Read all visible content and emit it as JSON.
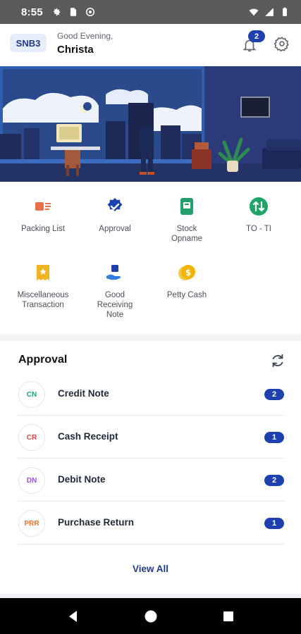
{
  "status_bar": {
    "time": "8:55",
    "left_icons": [
      "gear-icon",
      "sim-card-icon",
      "settings-cog-icon"
    ],
    "right_icons": [
      "wifi-icon",
      "cellular-icon",
      "battery-icon"
    ]
  },
  "header": {
    "store_code": "SNB3",
    "greeting": "Good Evening,",
    "user_name": "Christa",
    "notification_count": "2"
  },
  "menu": {
    "items": [
      {
        "label": "Packing List",
        "icon": "packing-list-icon",
        "color": "#e8704a"
      },
      {
        "label": "Approval",
        "icon": "approval-check-icon",
        "color": "#1e40af"
      },
      {
        "label": "Stock Opname",
        "icon": "stock-opname-icon",
        "color": "#22a06b"
      },
      {
        "label": "TO - TI",
        "icon": "transfer-icon",
        "color": "#1fa56a"
      },
      {
        "label": "Miscellaneous Transaction",
        "icon": "misc-receipt-icon",
        "color": "#f0b323"
      },
      {
        "label": "Good Receiving Note",
        "icon": "receiving-hand-icon",
        "color": "#1e40af"
      },
      {
        "label": "Petty Cash",
        "icon": "coin-icon",
        "color": "#f4b400"
      }
    ]
  },
  "approval": {
    "title": "Approval",
    "rows": [
      {
        "code": "CN",
        "label": "Credit Note",
        "count": "2",
        "code_color": "#1fa56a"
      },
      {
        "code": "CR",
        "label": "Cash Receipt",
        "count": "1",
        "code_color": "#e0433f"
      },
      {
        "code": "DN",
        "label": "Debit Note",
        "count": "2",
        "code_color": "#9b51e0"
      },
      {
        "code": "PRR",
        "label": "Purchase Return",
        "count": "1",
        "code_color": "#e8732a"
      }
    ],
    "view_all": "View All"
  },
  "nav": {
    "buttons": [
      "back-icon",
      "home-icon",
      "recents-icon"
    ]
  },
  "colors": {
    "accent": "#1e40af",
    "status_bar": "#5b5b5b"
  }
}
